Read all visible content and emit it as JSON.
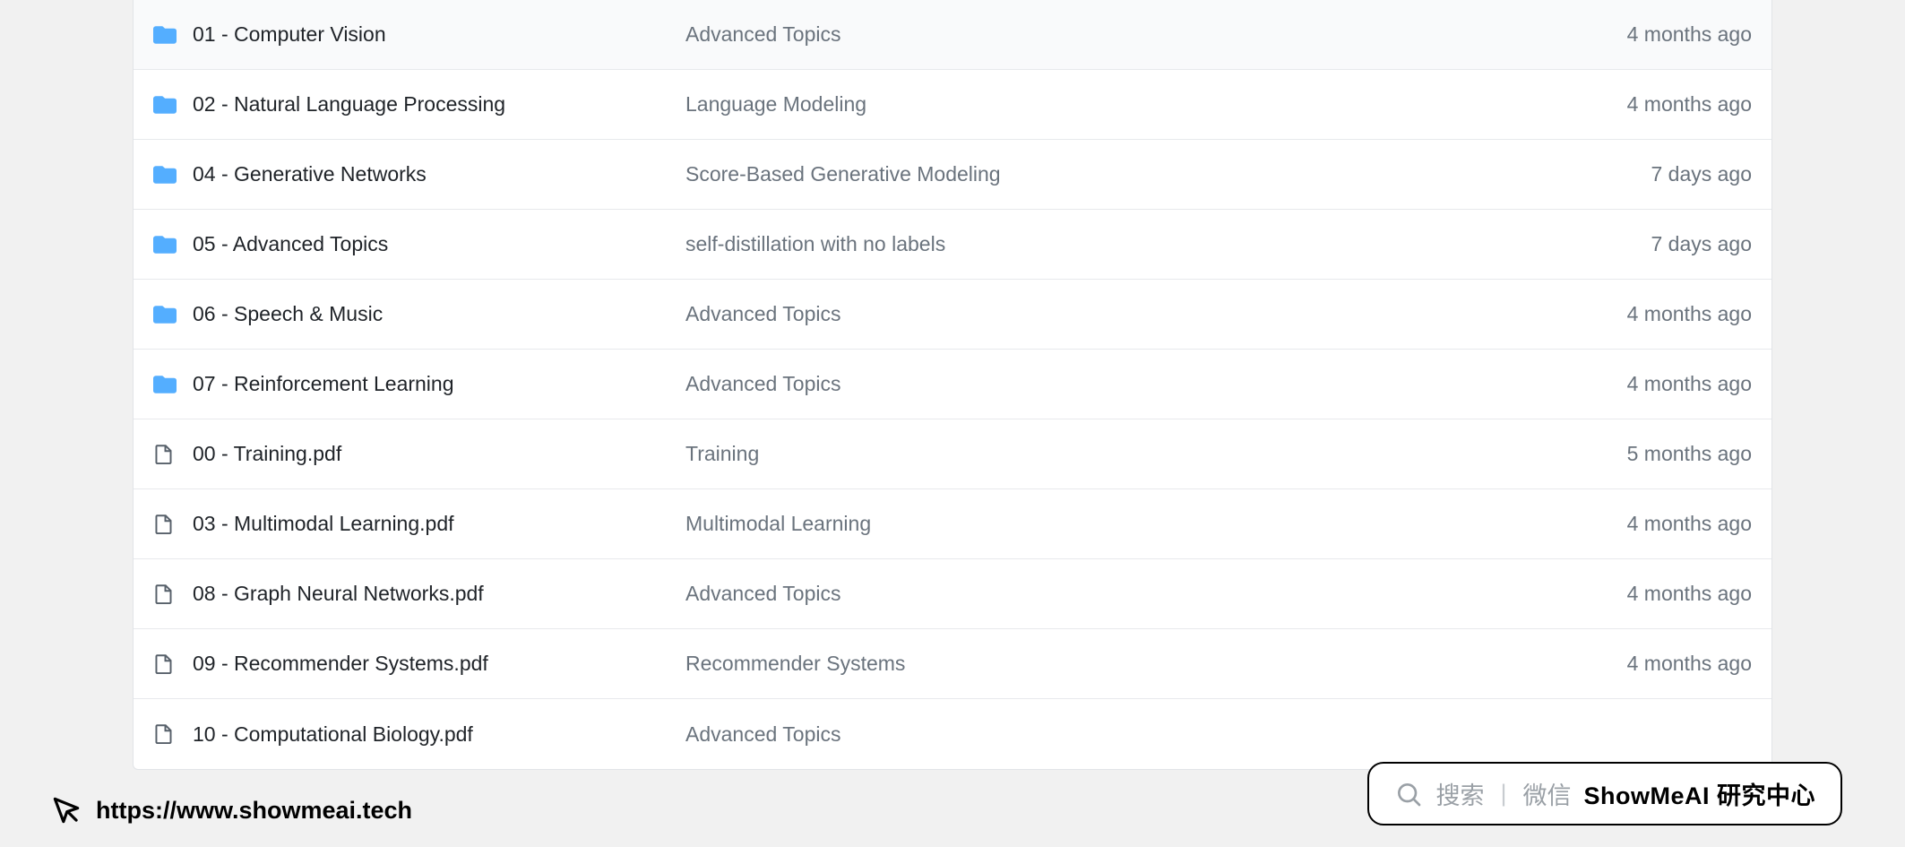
{
  "files": [
    {
      "type": "folder",
      "name": "01 - Computer Vision",
      "desc": "Advanced Topics",
      "time": "4 months ago"
    },
    {
      "type": "folder",
      "name": "02 - Natural Language Processing",
      "desc": "Language Modeling",
      "time": "4 months ago"
    },
    {
      "type": "folder",
      "name": "04 - Generative Networks",
      "desc": "Score-Based Generative Modeling",
      "time": "7 days ago"
    },
    {
      "type": "folder",
      "name": "05 - Advanced Topics",
      "desc": "self-distillation with no labels",
      "time": "7 days ago"
    },
    {
      "type": "folder",
      "name": "06 - Speech & Music",
      "desc": "Advanced Topics",
      "time": "4 months ago"
    },
    {
      "type": "folder",
      "name": "07 - Reinforcement Learning",
      "desc": "Advanced Topics",
      "time": "4 months ago"
    },
    {
      "type": "file",
      "name": "00 - Training.pdf",
      "desc": "Training",
      "time": "5 months ago"
    },
    {
      "type": "file",
      "name": "03 - Multimodal Learning.pdf",
      "desc": "Multimodal Learning",
      "time": "4 months ago"
    },
    {
      "type": "file",
      "name": "08 - Graph Neural Networks.pdf",
      "desc": "Advanced Topics",
      "time": "4 months ago"
    },
    {
      "type": "file",
      "name": "09 - Recommender Systems.pdf",
      "desc": "Recommender Systems",
      "time": "4 months ago"
    },
    {
      "type": "file",
      "name": "10 - Computational Biology.pdf",
      "desc": "Advanced Topics",
      "time": ""
    }
  ],
  "footer_url": "https://www.showmeai.tech",
  "search": {
    "placeholder": "搜索",
    "sep": "|",
    "hint": "微信",
    "brand": "ShowMeAI 研究中心"
  }
}
